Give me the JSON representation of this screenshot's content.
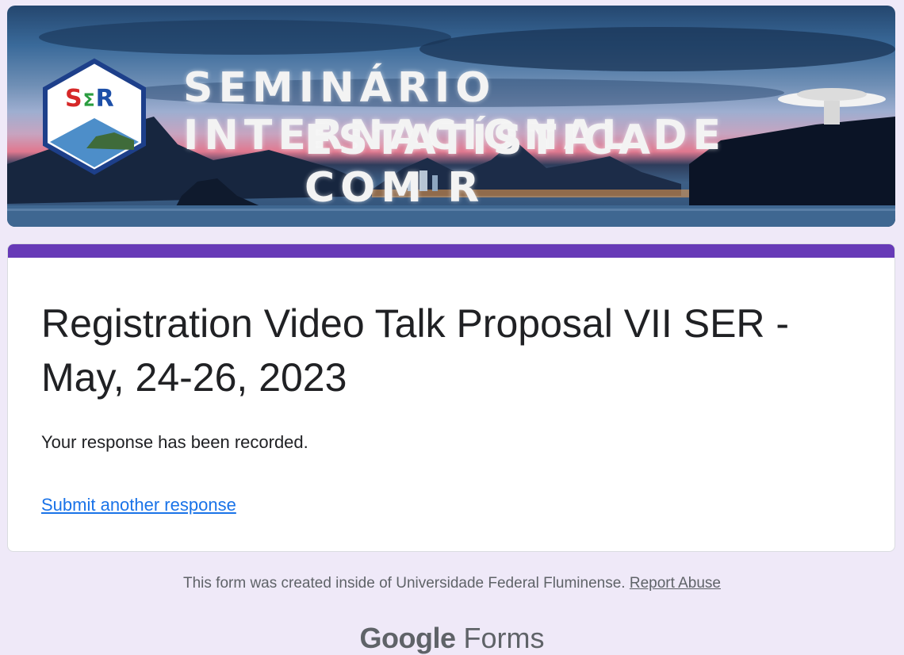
{
  "banner": {
    "line1": "SEMINÁRIO INTERNACIONAL DE",
    "line2": "ESTATÍSTICA COM R",
    "logo_text": "SΣR",
    "logo_colors": {
      "s": "#d62828",
      "sigma": "#2a9d3f",
      "r": "#1d4fa8"
    }
  },
  "form": {
    "accent_color": "#673ab7",
    "title": "Registration Video Talk Proposal VII SER - May, 24-26, 2023",
    "confirmation": "Your response has been recorded.",
    "submit_another": "Submit another response"
  },
  "footer": {
    "note": "This form was created inside of Universidade Federal Fluminense.",
    "report_abuse": "Report Abuse",
    "brand_google": "Google",
    "brand_forms": "Forms"
  }
}
